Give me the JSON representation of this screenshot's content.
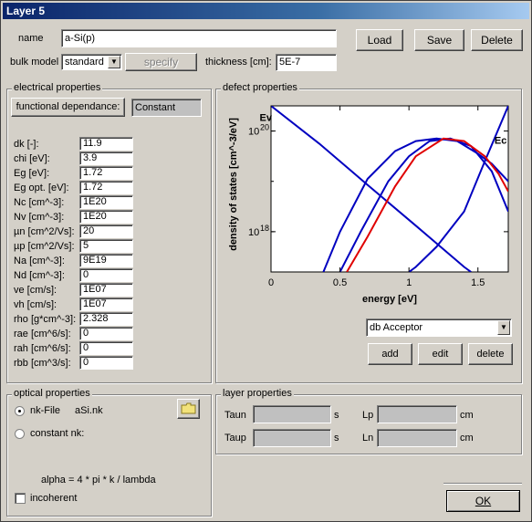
{
  "window": {
    "title": "Layer 5"
  },
  "top": {
    "name_label": "name",
    "name_value": "a-Si(p)",
    "bulk_model_label": "bulk model",
    "bulk_model_value": "standard",
    "specify_label": "specify",
    "thickness_label": "thickness [cm]:",
    "thickness_value": "5E-7",
    "load_label": "Load",
    "save_label": "Save",
    "delete_label": "Delete"
  },
  "electrical": {
    "title": "electrical properties",
    "functional_label": "functional dependance:",
    "constant_value": "Constant",
    "params": [
      {
        "label": "dk [-]:",
        "value": "11.9"
      },
      {
        "label": "chi [eV]:",
        "value": "3.9"
      },
      {
        "label": "Eg [eV]:",
        "value": "1.72"
      },
      {
        "label": "Eg opt. [eV]:",
        "value": "1.72"
      },
      {
        "label": "Nc [cm^-3]:",
        "value": "1E20"
      },
      {
        "label": "Nv [cm^-3]:",
        "value": "1E20"
      },
      {
        "label": "µn [cm^2/Vs]:",
        "value": "20"
      },
      {
        "label": "µp [cm^2/Vs]:",
        "value": "5"
      },
      {
        "label": "Na [cm^-3]:",
        "value": "9E19"
      },
      {
        "label": "Nd [cm^-3]:",
        "value": "0"
      },
      {
        "label": "ve [cm/s]:",
        "value": "1E07"
      },
      {
        "label": "vh [cm/s]:",
        "value": "1E07"
      },
      {
        "label": "rho [g*cm^-3]:",
        "value": "2.328"
      },
      {
        "label": "rae [cm^6/s]:",
        "value": "0"
      },
      {
        "label": "rah [cm^6/s]:",
        "value": "0"
      },
      {
        "label": "rbb [cm^3/s]:",
        "value": "0"
      }
    ]
  },
  "defect": {
    "title": "defect properties",
    "selected_defect": "db Acceptor",
    "add_label": "add",
    "edit_label": "edit",
    "delete_label": "delete"
  },
  "chart_data": {
    "type": "line",
    "xlabel": "energy [eV]",
    "ylabel": "density of states [cm^-3/eV]",
    "xlim": [
      0,
      1.72
    ],
    "x_ticks": [
      "0",
      "0.5",
      "1",
      "1.5"
    ],
    "x_tick_values": [
      0,
      0.5,
      1,
      1.5
    ],
    "y_log": true,
    "ylim_log10": [
      17.2,
      20.5
    ],
    "y_tick_base": "10",
    "y_tick_exponents": [
      "18",
      "20"
    ],
    "y_tick_values_log10": [
      18,
      20
    ],
    "annotations": [
      {
        "text": "Ev",
        "x": 0.05,
        "y_log10": 20.2
      },
      {
        "text": "Ec",
        "x": 1.62,
        "y_log10": 19.75
      }
    ],
    "series": [
      {
        "color": "#0000c0",
        "style": "tail",
        "points": [
          [
            0,
            20.5
          ],
          [
            0.35,
            19.75
          ],
          [
            0.7,
            18.93
          ],
          [
            1.05,
            18.12
          ],
          [
            1.4,
            17.3
          ],
          [
            1.45,
            17.2
          ]
        ]
      },
      {
        "color": "#0000c0",
        "style": "tail",
        "points": [
          [
            1.0,
            17.2
          ],
          [
            1.05,
            17.3
          ],
          [
            1.2,
            17.7
          ],
          [
            1.4,
            18.4
          ],
          [
            1.55,
            19.4
          ],
          [
            1.72,
            20.5
          ]
        ]
      },
      {
        "color": "#0000c0",
        "style": "gaussian",
        "points": [
          [
            0.38,
            17.2
          ],
          [
            0.5,
            18.0
          ],
          [
            0.7,
            19.05
          ],
          [
            0.9,
            19.6
          ],
          [
            1.05,
            19.8
          ],
          [
            1.2,
            19.85
          ],
          [
            1.35,
            19.8
          ],
          [
            1.5,
            19.55
          ],
          [
            1.6,
            19.35
          ],
          [
            1.72,
            19.0
          ]
        ]
      },
      {
        "color": "#0000c0",
        "style": "gaussian",
        "points": [
          [
            0.5,
            17.2
          ],
          [
            0.65,
            18.0
          ],
          [
            0.85,
            19.0
          ],
          [
            1.0,
            19.5
          ],
          [
            1.15,
            19.8
          ],
          [
            1.3,
            19.85
          ],
          [
            1.45,
            19.7
          ],
          [
            1.6,
            19.2
          ],
          [
            1.72,
            18.4
          ]
        ]
      },
      {
        "color": "#e00000",
        "style": "gaussian",
        "points": [
          [
            0.55,
            17.2
          ],
          [
            0.7,
            17.9
          ],
          [
            0.9,
            18.9
          ],
          [
            1.05,
            19.5
          ],
          [
            1.25,
            19.85
          ],
          [
            1.4,
            19.8
          ],
          [
            1.55,
            19.5
          ],
          [
            1.65,
            19.15
          ],
          [
            1.72,
            18.8
          ]
        ]
      }
    ]
  },
  "optical": {
    "title": "optical properties",
    "nk_file_label": "nk-File",
    "nk_file_value": "aSi.nk",
    "constant_nk_label": "constant nk:",
    "formula": "alpha = 4 * pi * k / lambda",
    "incoherent_label": "incoherent"
  },
  "layer": {
    "title": "layer properties",
    "taun_label": "Taun",
    "taup_label": "Taup",
    "lp_label": "Lp",
    "ln_label": "Ln",
    "s_unit": "s",
    "cm_unit": "cm"
  },
  "ok_label": "OK"
}
